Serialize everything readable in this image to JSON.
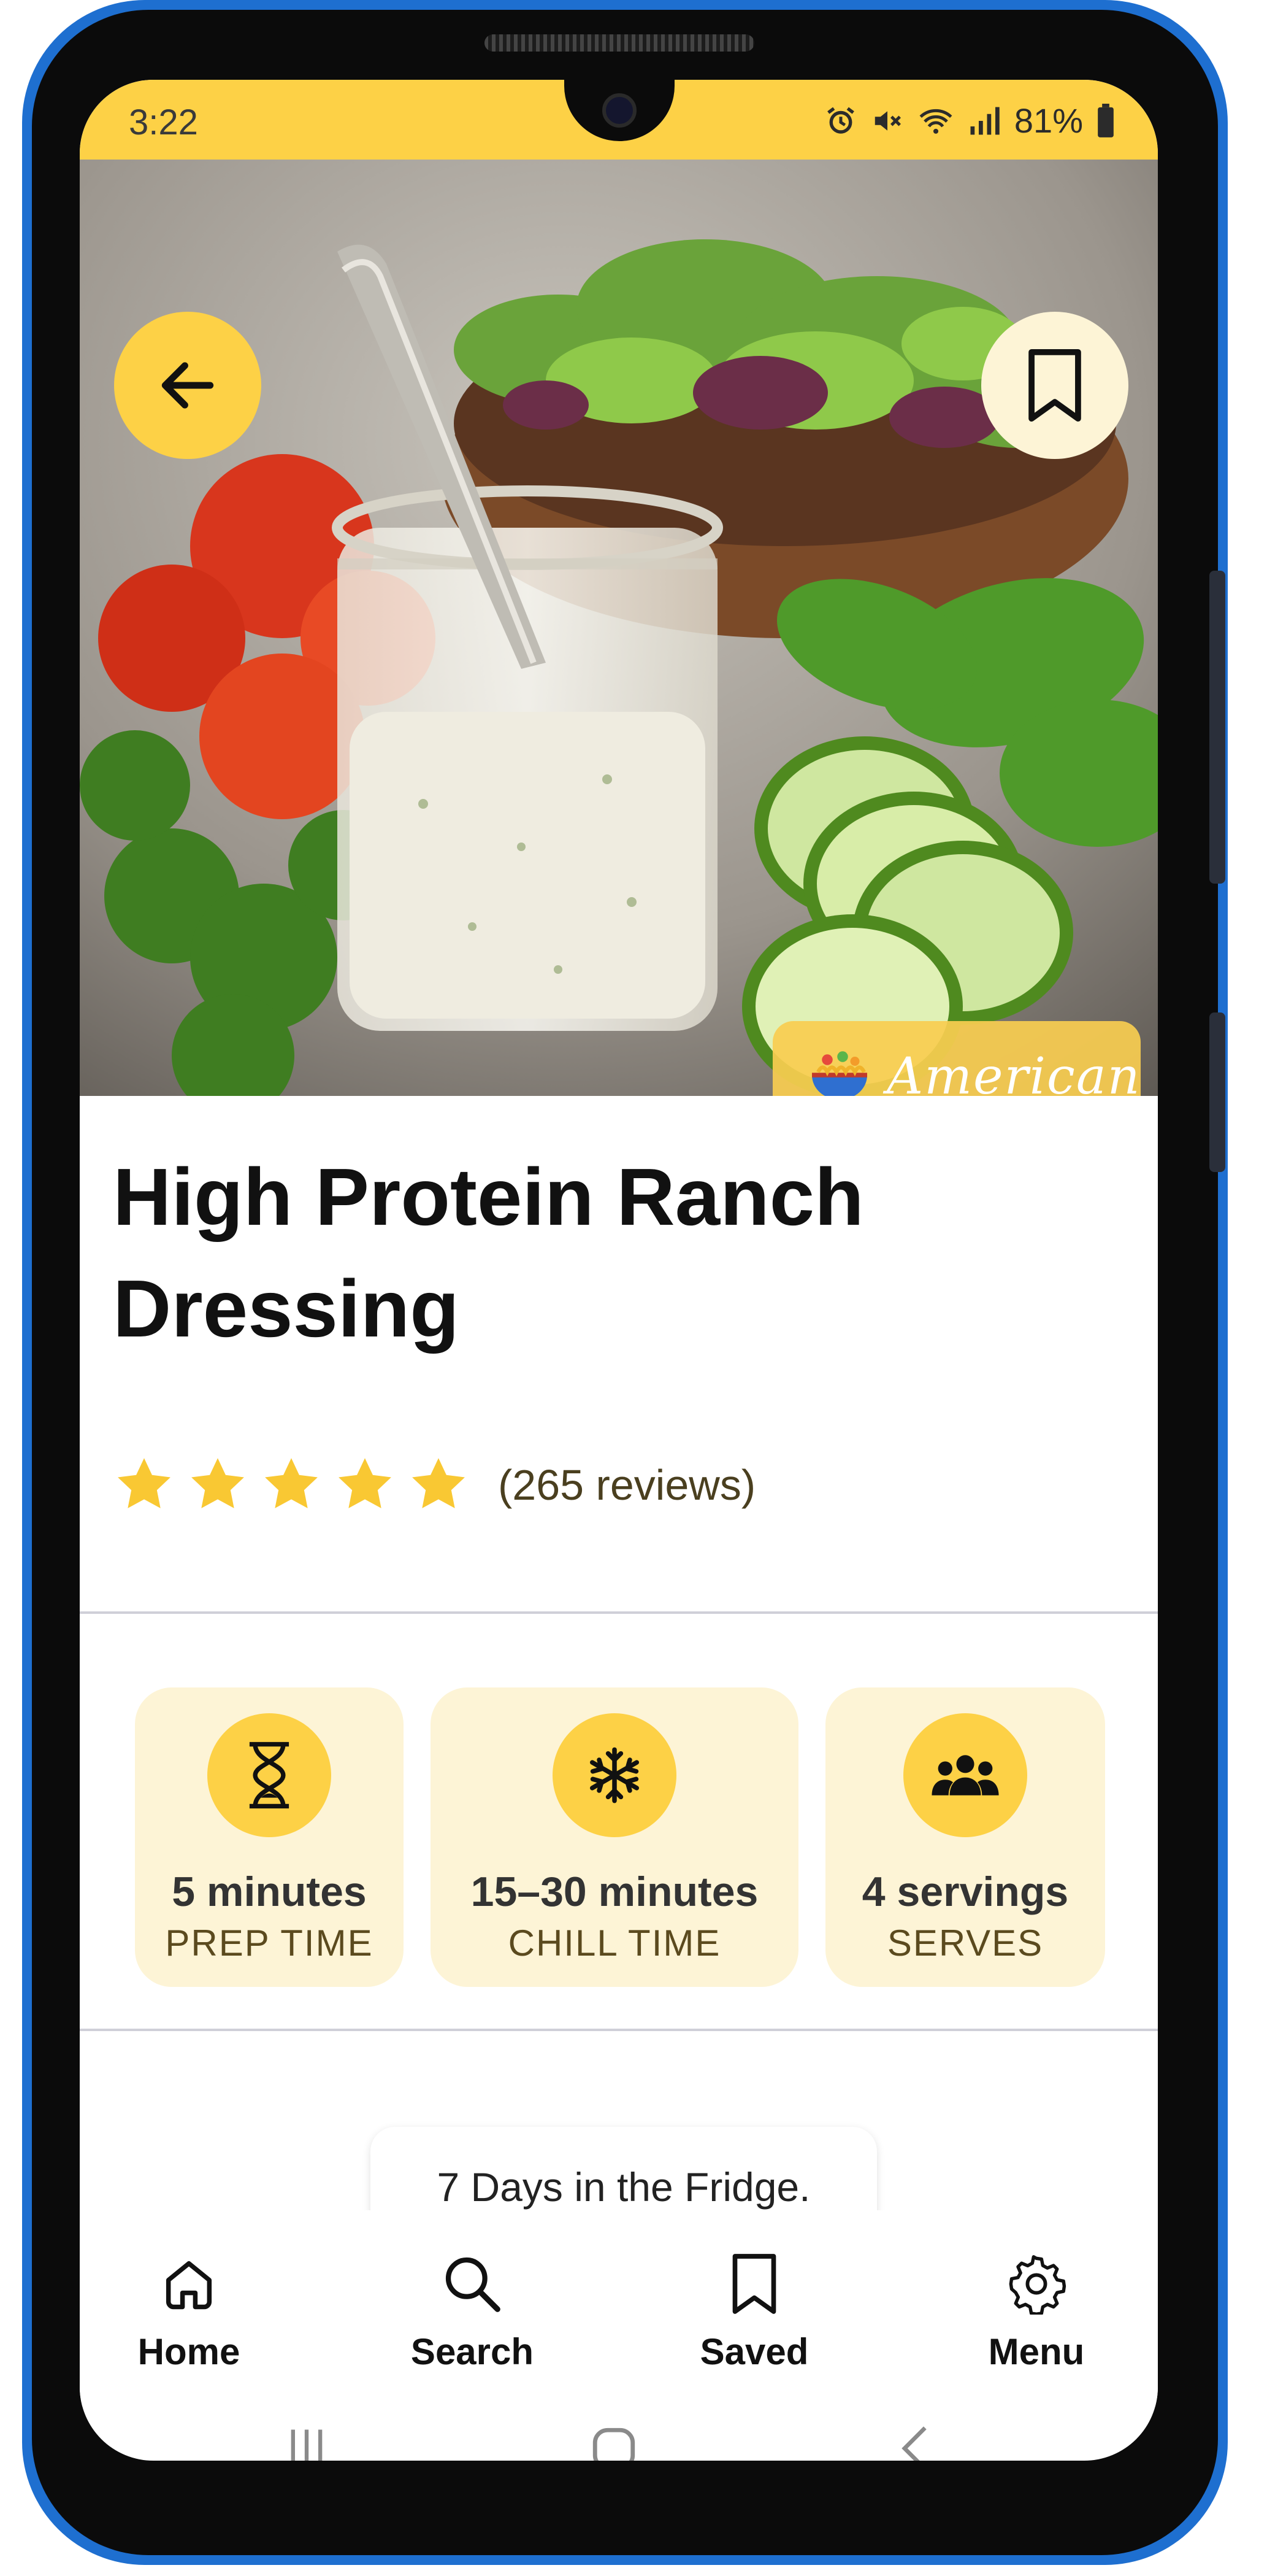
{
  "status_bar": {
    "time": "3:22",
    "battery": "81%",
    "icons": [
      "alarm-icon",
      "mute-icon",
      "wifi-icon",
      "signal-icon",
      "battery-icon"
    ]
  },
  "hero": {
    "back_icon": "arrow-left-icon",
    "bookmark_icon": "bookmark-icon",
    "cuisine": {
      "label": "American",
      "icon": "noodle-bowl-icon"
    }
  },
  "recipe": {
    "title_line1": "High Protein Ranch",
    "title_line2": "Dressing",
    "rating": 5,
    "reviews": "(265 reviews)"
  },
  "info_cards": [
    {
      "icon": "hourglass-icon",
      "value": "5 minutes",
      "label": "PREP TIME"
    },
    {
      "icon": "snowflake-icon",
      "value": "15–30 minutes",
      "label": "CHILL TIME"
    },
    {
      "icon": "users-icon",
      "value": "4 servings",
      "label": "SERVES"
    }
  ],
  "toast": {
    "text": "7 Days in the Fridge."
  },
  "bottom_nav": [
    {
      "icon": "home-icon",
      "label": "Home"
    },
    {
      "icon": "search-icon",
      "label": "Search"
    },
    {
      "icon": "bookmark-icon",
      "label": "Saved"
    },
    {
      "icon": "gear-icon",
      "label": "Menu"
    }
  ],
  "colors": {
    "accent": "#fdd146",
    "card_bg": "#fdf4d6",
    "frame": "#1e6fd0"
  }
}
